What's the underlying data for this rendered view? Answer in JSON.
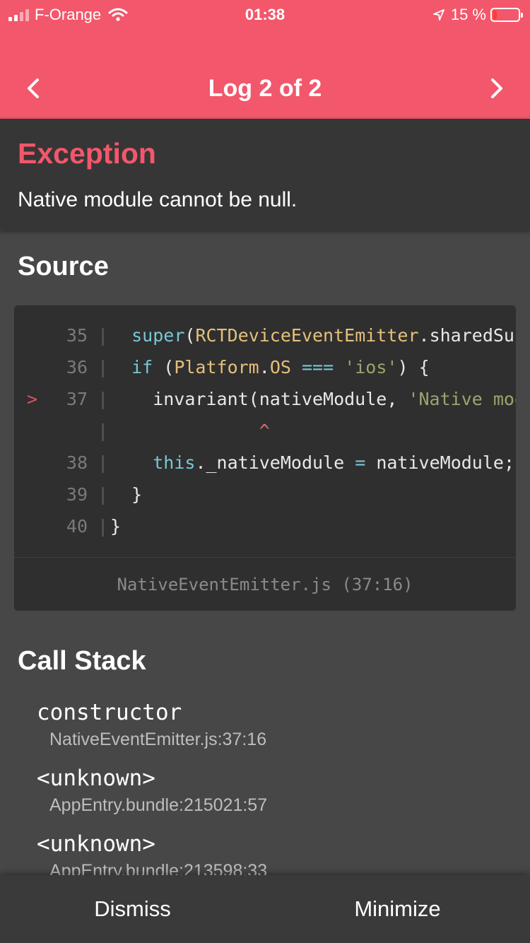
{
  "status_bar": {
    "carrier": "F-Orange",
    "time": "01:38",
    "battery_percent": "15 %",
    "battery_level": 0.15,
    "icons": [
      "signal-icon",
      "wifi-icon",
      "location-arrow-icon",
      "battery-icon"
    ]
  },
  "nav": {
    "title": "Log 2 of 2",
    "prev_icon": "chevron-left-icon",
    "next_icon": "chevron-right-icon"
  },
  "exception": {
    "title": "Exception",
    "message": "Native module cannot be null."
  },
  "source": {
    "title": "Source",
    "lines": [
      {
        "marker": "",
        "num": "35",
        "gutter": "|",
        "code": [
          {
            "t": "  "
          },
          {
            "t": "super",
            "c": "kw"
          },
          {
            "t": "("
          },
          {
            "t": "RCTDeviceEventEmitter",
            "c": "cls"
          },
          {
            "t": ".sharedSubscriber"
          }
        ]
      },
      {
        "marker": "",
        "num": "36",
        "gutter": "|",
        "code": [
          {
            "t": "  "
          },
          {
            "t": "if",
            "c": "kw"
          },
          {
            "t": " ("
          },
          {
            "t": "Platform",
            "c": "cls"
          },
          {
            "t": "."
          },
          {
            "t": "OS",
            "c": "cls"
          },
          {
            "t": " "
          },
          {
            "t": "===",
            "c": "kw"
          },
          {
            "t": " "
          },
          {
            "t": "'ios'",
            "c": "str"
          },
          {
            "t": ") {"
          }
        ]
      },
      {
        "marker": ">",
        "num": "37",
        "gutter": "|",
        "code": [
          {
            "t": "    invariant(nativeModule, "
          },
          {
            "t": "'Native module cannot be null.'",
            "c": "str"
          }
        ]
      },
      {
        "marker": "",
        "num": "",
        "gutter": "|",
        "code": [
          {
            "t": "              "
          },
          {
            "t": "^",
            "c": "caret"
          }
        ]
      },
      {
        "marker": "",
        "num": "38",
        "gutter": "|",
        "code": [
          {
            "t": "    "
          },
          {
            "t": "this",
            "c": "kw"
          },
          {
            "t": "._nativeModule "
          },
          {
            "t": "=",
            "c": "kw"
          },
          {
            "t": " nativeModule;"
          }
        ]
      },
      {
        "marker": "",
        "num": "39",
        "gutter": "|",
        "code": [
          {
            "t": "  }"
          }
        ]
      },
      {
        "marker": "",
        "num": "40",
        "gutter": "|",
        "code": [
          {
            "t": "}"
          }
        ]
      }
    ],
    "file_location": "NativeEventEmitter.js (37:16)"
  },
  "call_stack": {
    "title": "Call Stack",
    "frames": [
      {
        "method": "constructor",
        "file": "NativeEventEmitter.js:37:16"
      },
      {
        "method": "<unknown>",
        "file": "AppEntry.bundle:215021:57"
      },
      {
        "method": "<unknown>",
        "file": "AppEntry.bundle:213598:33"
      }
    ]
  },
  "footer": {
    "dismiss_label": "Dismiss",
    "minimize_label": "Minimize"
  },
  "colors": {
    "accent": "#f2576b",
    "background": "#474747",
    "panel": "#363636",
    "code_bg": "#2f2f2f"
  }
}
